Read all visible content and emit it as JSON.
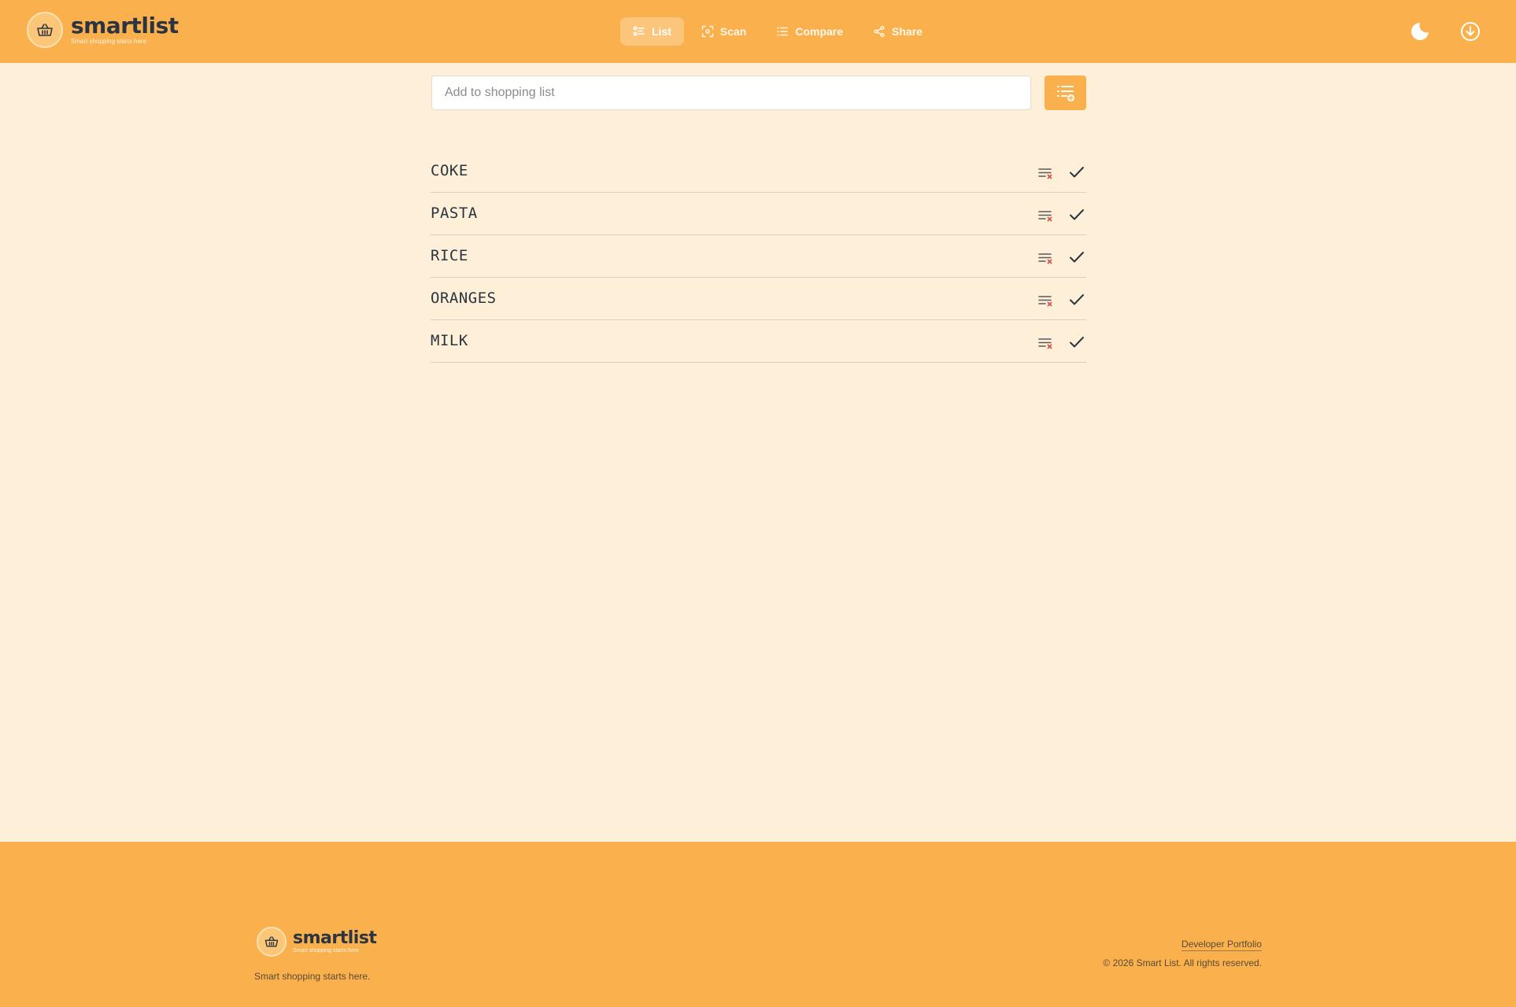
{
  "brand": {
    "name": "smartlist",
    "tagline": "Smart shopping starts here"
  },
  "nav": {
    "items": [
      {
        "label": "List",
        "icon": "list-icon",
        "active": true
      },
      {
        "label": "Scan",
        "icon": "scan-icon",
        "active": false
      },
      {
        "label": "Compare",
        "icon": "compare-icon",
        "active": false
      },
      {
        "label": "Share",
        "icon": "share-icon",
        "active": false
      }
    ]
  },
  "header_actions": {
    "theme_icon": "moon-icon",
    "install_icon": "download-icon"
  },
  "add_item": {
    "placeholder": "Add to shopping list",
    "value": "",
    "button_icon": "add-list-icon"
  },
  "shopping_list": {
    "items": [
      {
        "name": "COKE"
      },
      {
        "name": "PASTA"
      },
      {
        "name": "RICE"
      },
      {
        "name": "ORANGES"
      },
      {
        "name": "MILK"
      }
    ],
    "remove_icon": "remove-item-icon",
    "check_icon": "check-icon"
  },
  "footer": {
    "brand_name": "smartlist",
    "brand_tagline": "Smart shopping starts here",
    "tagline": "Smart shopping starts here.",
    "link": "Developer Portfolio",
    "copyright": "© 2026 Smart List. All rights reserved."
  },
  "colors": {
    "header_bg": "#fab14d",
    "page_bg": "#fdefd8",
    "remove_icon": "#d9534f",
    "text": "#2b3441"
  }
}
